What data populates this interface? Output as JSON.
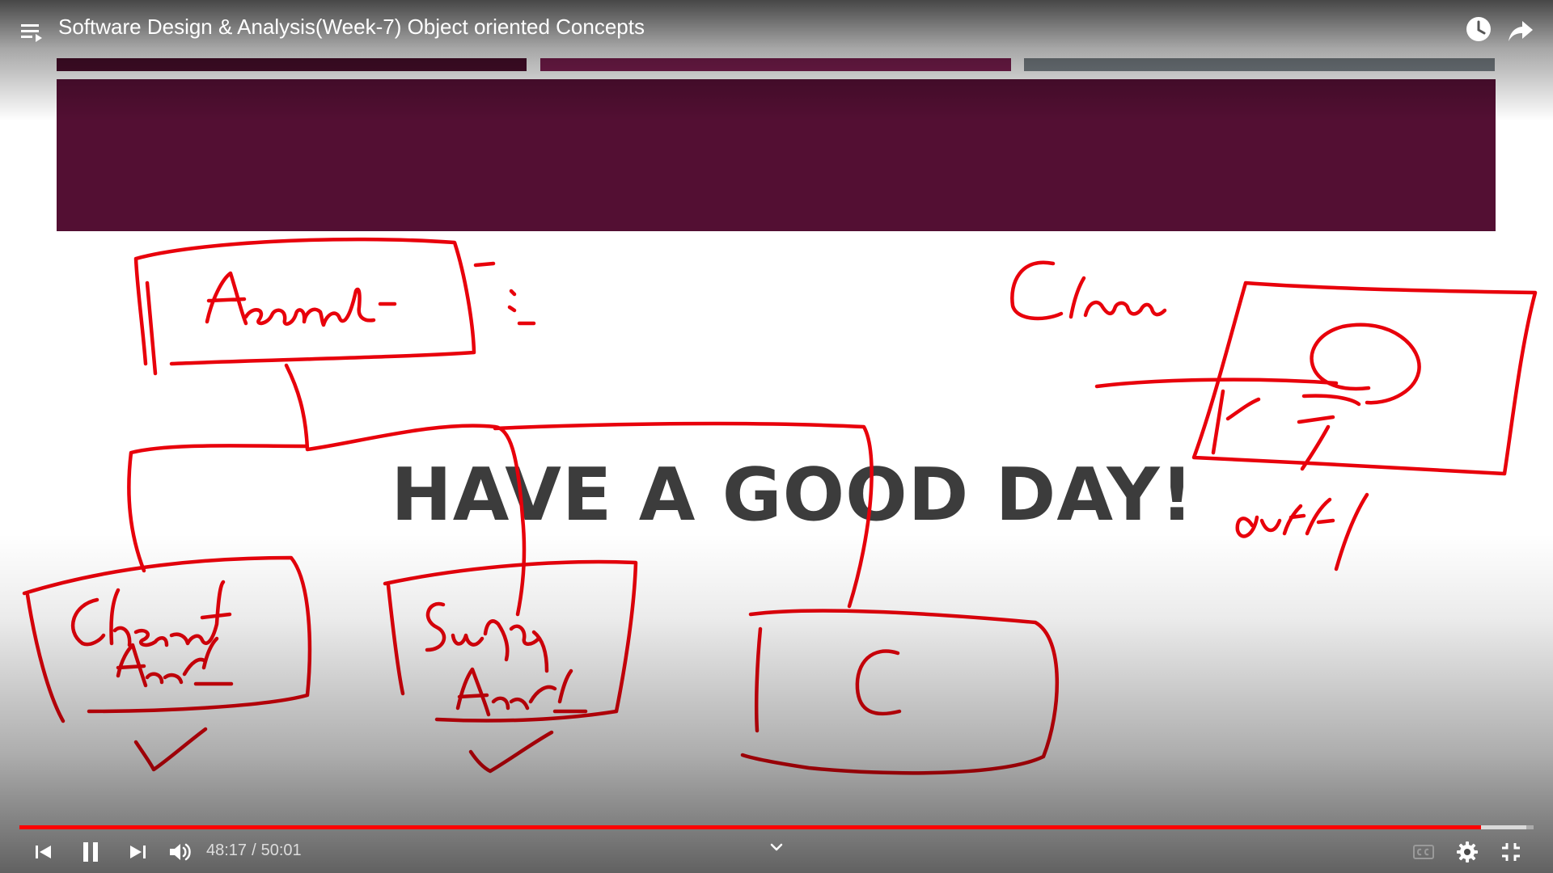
{
  "player": {
    "title": "Software Design & Analysis(Week-7) Object oriented Concepts",
    "current_time": "48:17",
    "duration": "50:01",
    "time_separator": "/",
    "progress_fraction": 0.9653,
    "buffered_fraction": 0.995,
    "accent_color": "#ff0000"
  },
  "slide": {
    "heading": "HAVE A GOOD DAY!",
    "bar_colors": [
      "#4a0e2c",
      "#7c1e50",
      "#7b8389"
    ],
    "banner_color": "#530f33",
    "ink_color": "#e8000b"
  },
  "icons": {
    "playlist": "playlist-icon",
    "watch_later": "clock-icon",
    "share": "share-arrow-icon",
    "previous": "skip-previous-icon",
    "pause": "pause-icon",
    "next": "skip-next-icon",
    "volume": "volume-icon",
    "chevron": "chevron-down-icon",
    "captions": "captions-icon",
    "settings": "gear-icon",
    "exit_fullscreen": "exit-fullscreen-icon"
  }
}
